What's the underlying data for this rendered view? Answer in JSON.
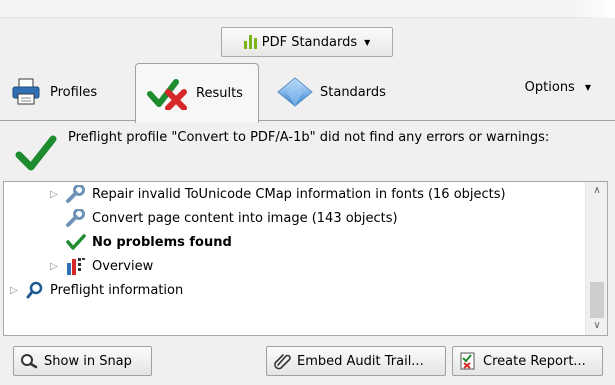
{
  "standards_button": {
    "label": "PDF Standards"
  },
  "tabs": [
    {
      "label": "Profiles"
    },
    {
      "label": "Results"
    },
    {
      "label": "Standards"
    }
  ],
  "options": {
    "label": "Options"
  },
  "summary": {
    "message": "Preflight profile \"Convert to PDF/A-1b\" did not find any errors or warnings:"
  },
  "tree": {
    "items": [
      {
        "label": "Repair invalid ToUnicode CMap information in fonts (16 objects)",
        "icon": "wrench-icon",
        "expandable": true
      },
      {
        "label": "Convert page content into image (143 objects)",
        "icon": "wrench-icon",
        "expandable": false
      },
      {
        "label": "No problems found",
        "icon": "checkmark-icon",
        "expandable": false
      },
      {
        "label": "Overview",
        "icon": "overview-chart-icon",
        "expandable": true
      },
      {
        "label": "Preflight information",
        "icon": "magnifier-icon",
        "expandable": true
      }
    ]
  },
  "buttons": {
    "show_in_snap": "Show in Snap",
    "embed_audit_trail": "Embed Audit Trail...",
    "create_report": "Create Report..."
  },
  "colors": {
    "check_green": "#1e8c2e",
    "accent_green": "#7cb518",
    "error_red": "#d62828",
    "wrench_blue": "#6f93b8"
  }
}
